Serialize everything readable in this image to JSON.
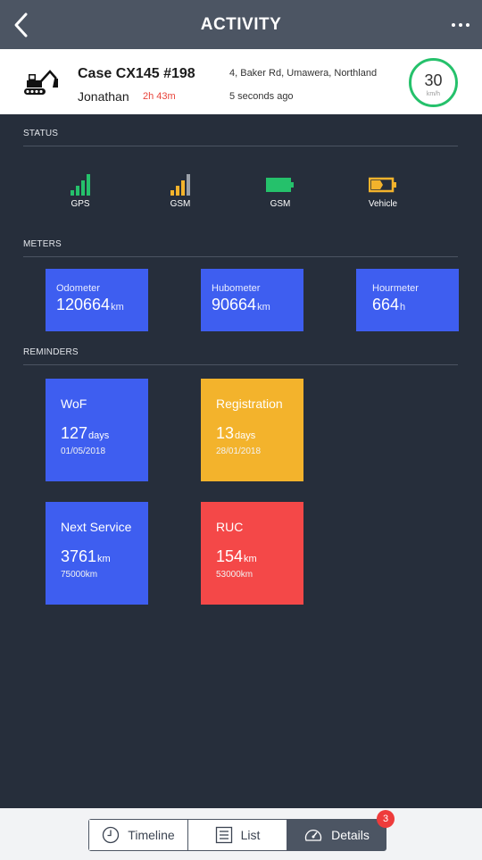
{
  "header": {
    "title": "ACTIVITY"
  },
  "vehicle": {
    "name": "Case CX145 #198",
    "driver": "Jonathan",
    "duration": "2h 43m",
    "address": "4, Baker Rd, Umawera, Northland",
    "last_update": "5 seconds ago",
    "speed": "30",
    "speed_unit": "km/h"
  },
  "status": {
    "section_label": "STATUS",
    "items": [
      {
        "label": "GPS",
        "icon": "signal-bars-icon",
        "level": 4,
        "color": "#25c16b"
      },
      {
        "label": "GSM",
        "icon": "signal-bars-icon",
        "level": 3,
        "color": "#f3b32c"
      },
      {
        "label": "GSM",
        "icon": "battery-icon",
        "level": 1.0,
        "color": "#25c16b"
      },
      {
        "label": "Vehicle",
        "icon": "battery-charging-icon",
        "level": 0.5,
        "color": "#f3b32c"
      }
    ]
  },
  "meters": {
    "section_label": "METERS",
    "items": [
      {
        "label": "Odometer",
        "value": "120664",
        "unit": "km"
      },
      {
        "label": "Hubometer",
        "value": "90664",
        "unit": "km"
      },
      {
        "label": "Hourmeter",
        "value": "664",
        "unit": "h"
      }
    ]
  },
  "reminders": {
    "section_label": "REMINDERS",
    "items": [
      {
        "label": "WoF",
        "value": "127",
        "unit": "days",
        "sub": "01/05/2018",
        "color": "#3e5ef0"
      },
      {
        "label": "Registration",
        "value": "13",
        "unit": "days",
        "sub": "28/01/2018",
        "color": "#f3b32c"
      },
      {
        "label": "Next Service",
        "value": "3761",
        "unit": "km",
        "sub": "75000km",
        "color": "#3e5ef0"
      },
      {
        "label": "RUC",
        "value": "154",
        "unit": "km",
        "sub": "53000km",
        "color": "#f44848"
      }
    ]
  },
  "tabs": {
    "items": [
      {
        "label": "Timeline",
        "icon": "clock-icon"
      },
      {
        "label": "List",
        "icon": "list-icon"
      },
      {
        "label": "Details",
        "icon": "speedometer-icon"
      }
    ],
    "active": "Details",
    "badge": "3"
  },
  "colors": {
    "background": "#262e3b",
    "navbar": "#4c5563",
    "accent_blue": "#3e5ef0",
    "warning": "#f3b32c",
    "danger": "#f44848",
    "success": "#25c16b"
  }
}
